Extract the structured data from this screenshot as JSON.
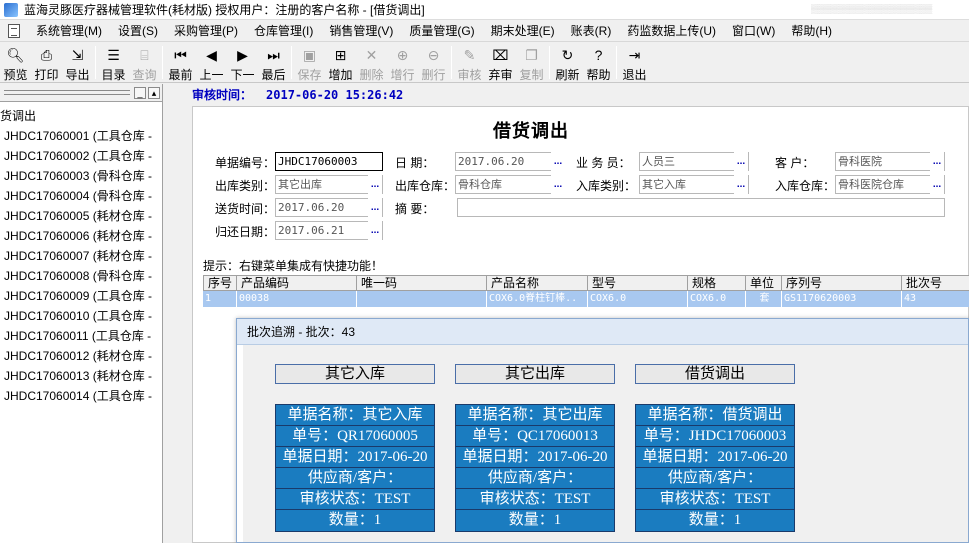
{
  "window": {
    "title": "蓝海灵豚医疗器械管理软件(耗材版)    授权用户：注册的客户名称 - [借货调出]"
  },
  "menu": [
    "系统管理(M)",
    "设置(S)",
    "采购管理(P)",
    "仓库管理(I)",
    "销售管理(V)",
    "质量管理(G)",
    "期末处理(E)",
    "账表(R)",
    "药监数据上传(U)",
    "窗口(W)",
    "帮助(H)"
  ],
  "toolbar": {
    "preview": "预览",
    "print": "打印",
    "export": "导出",
    "catalog": "目录",
    "query": "查询",
    "first": "最前",
    "prev": "上一",
    "next": "下一",
    "last": "最后",
    "save": "保存",
    "add": "增加",
    "delete": "删除",
    "add_row": "增行",
    "delete_row": "删行",
    "approve": "审核",
    "abandon": "弃审",
    "copy": "复制",
    "refresh": "刷新",
    "help": "帮助",
    "exit": "退出"
  },
  "left_panel": {
    "root": "货调出",
    "items": [
      "JHDC17060001 (工具仓库 -",
      "JHDC17060002 (工具仓库 -",
      "JHDC17060003 (骨科仓库 -",
      "JHDC17060004 (骨科仓库 -",
      "JHDC17060005 (耗材仓库 -",
      "JHDC17060006 (耗材仓库 -",
      "JHDC17060007 (耗材仓库 -",
      "JHDC17060008 (骨科仓库 -",
      "JHDC17060009 (工具仓库 -",
      "JHDC17060010 (工具仓库 -",
      "JHDC17060011 (工具仓库 -",
      "JHDC17060012 (耗材仓库 -",
      "JHDC17060013 (耗材仓库 -",
      "JHDC17060014 (工具仓库 -"
    ]
  },
  "audit": {
    "label": "审核时间：",
    "value": "2017-06-20 15:26:42"
  },
  "form": {
    "title": "借货调出",
    "doc_no_label": "单据编号：",
    "doc_no": "JHDC17060003",
    "date_label": "日    期：",
    "date": "2017.06.20",
    "salesman_label": "业 务 员：",
    "salesman": "人员三",
    "customer_label": "客    户：",
    "customer": "骨科医院",
    "out_type_label": "出库类别：",
    "out_type": "其它出库",
    "out_wh_label": "出库仓库：",
    "out_wh": "骨科仓库",
    "in_type_label": "入库类别：",
    "in_type": "其它入库",
    "in_wh_label": "入库仓库：",
    "in_wh": "骨科医院仓库",
    "delivery_label": "送货时间：",
    "delivery": "2017.06.20",
    "summary_label": "摘    要：",
    "summary": "",
    "return_label": "归还日期：",
    "return_date": "2017.06.21",
    "ellipsis": "..."
  },
  "hint": "提示：右键菜单集成有快捷功能！",
  "grid": {
    "headers": [
      "序号",
      "产品编码",
      "唯一码",
      "产品名称",
      "型号",
      "规格",
      "单位",
      "序列号",
      "批次号"
    ],
    "rows": [
      [
        "1",
        "00038",
        "",
        "COX6.0脊柱钉棒..",
        "COX6.0",
        "COX6.0",
        "套",
        "GS1170620003",
        "43"
      ]
    ]
  },
  "dialog": {
    "title": "批次追溯 - 批次：43",
    "stages": [
      {
        "name": "其它入库",
        "doc_name": "单据名称：其它入库",
        "doc_no": "单号：QR17060005",
        "doc_date": "单据日期：2017-06-20",
        "partner": "供应商/客户：",
        "status": "审核状态：TEST",
        "qty": "数量：1"
      },
      {
        "name": "其它出库",
        "doc_name": "单据名称：其它出库",
        "doc_no": "单号：QC17060013",
        "doc_date": "单据日期：2017-06-20",
        "partner": "供应商/客户：",
        "status": "审核状态：TEST",
        "qty": "数量：1"
      },
      {
        "name": "借货调出",
        "doc_name": "单据名称：借货调出",
        "doc_no": "单号：JHDC17060003",
        "doc_date": "单据日期：2017-06-20",
        "partner": "供应商/客户：",
        "status": "审核状态：TEST",
        "qty": "数量：1"
      }
    ]
  }
}
